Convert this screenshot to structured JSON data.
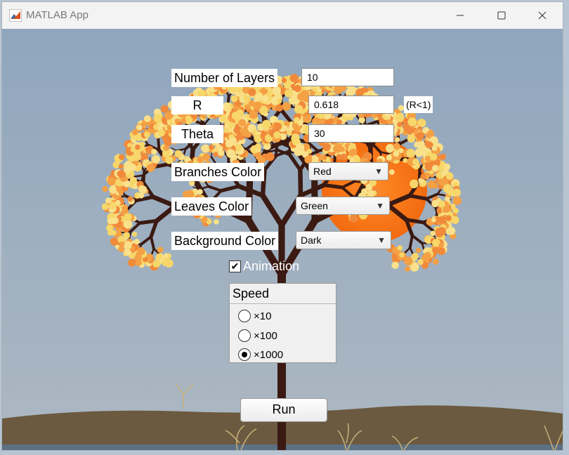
{
  "window": {
    "title": "MATLAB App"
  },
  "controls": {
    "layers": {
      "label": "Number of Layers",
      "value": "10"
    },
    "r": {
      "label": "R",
      "value": "0.618",
      "hint": "(R<1)"
    },
    "theta": {
      "label": "Theta",
      "value": "30"
    },
    "branches": {
      "label": "Branches Color",
      "selected": "Red"
    },
    "leaves": {
      "label": "Leaves Color",
      "selected": "Green"
    },
    "background": {
      "label": "Background Color",
      "selected": "Dark"
    },
    "animation": {
      "label": "Animation",
      "checked": true
    },
    "speed": {
      "title": "Speed",
      "options": [
        "×10",
        "×100",
        "×1000"
      ],
      "selected_index": 2
    },
    "run_label": "Run"
  },
  "colors": {
    "sky_top": "#8fa6bd",
    "sky_bottom": "#a9b6c1",
    "ground": "#6b5a40",
    "branch": "#3a1a12",
    "sun": "#ff7a1a",
    "leaf_light": "#f7d66a",
    "leaf_orange": "#f4a044"
  }
}
